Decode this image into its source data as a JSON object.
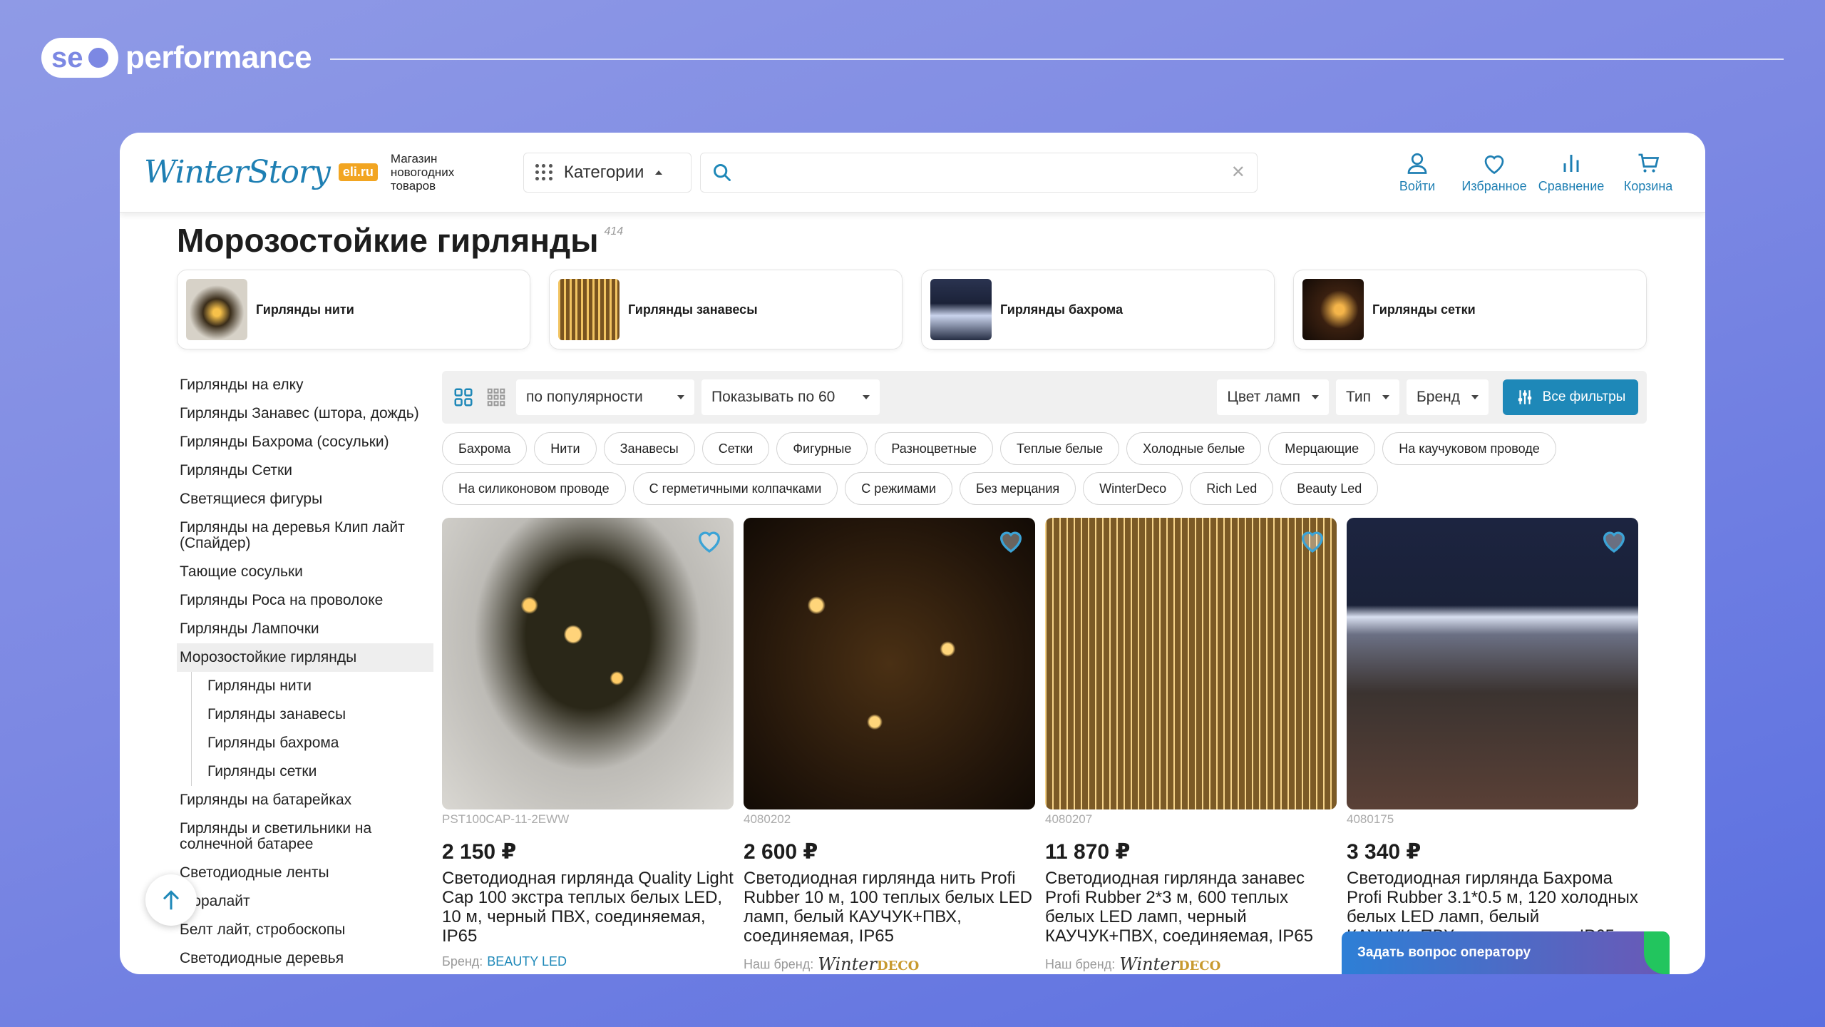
{
  "brand": {
    "pill": "se",
    "word": "performance"
  },
  "header": {
    "logo": "WinterStory",
    "logo_badge": "eli.ru",
    "logo_sub": "Магазин новогодних товаров",
    "categories": "Категории",
    "search_value": "",
    "actions": {
      "login": "Войти",
      "favorites": "Избранное",
      "compare": "Сравнение",
      "cart": "Корзина"
    }
  },
  "page": {
    "title": "Морозостойкие гирлянды",
    "count": "414"
  },
  "subcategories": [
    "Гирлянды нити",
    "Гирлянды занавесы",
    "Гирлянды бахрома",
    "Гирлянды сетки"
  ],
  "sidebar": {
    "items": [
      "Гирлянды на елку",
      "Гирлянды Занавес (штора, дождь)",
      "Гирлянды Бахрома (сосульки)",
      "Гирлянды Сетки",
      "Светящиеся фигуры",
      "Гирлянды на деревья Клип лайт (Спайдер)",
      "Тающие сосульки",
      "Гирлянды Роса на проволоке",
      "Гирлянды Лампочки"
    ],
    "active": "Морозостойкие гирлянды",
    "subitems": [
      "Гирлянды нити",
      "Гирлянды занавесы",
      "Гирлянды бахрома",
      "Гирлянды сетки"
    ],
    "items_after": [
      "Гирлянды на батарейках",
      "Гирлянды и светильники на солнечной батарее",
      "Светодиодные ленты",
      "Дюралайт",
      "Белт лайт, стробоскопы",
      "Светодиодные деревья"
    ]
  },
  "toolbar": {
    "sort": "по популярности",
    "per_page": "Показывать по 60",
    "lamp_color": "Цвет ламп",
    "type": "Тип",
    "brand": "Бренд",
    "all_filters": "Все фильтры"
  },
  "tags": [
    "Бахрома",
    "Нити",
    "Занавесы",
    "Сетки",
    "Фигурные",
    "Разноцветные",
    "Теплые белые",
    "Холодные белые",
    "Мерцающие",
    "На каучуковом проводе",
    "На силиконовом проводе",
    "С герметичными колпачками",
    "С режимами",
    "Без мерцания",
    "WinterDeco",
    "Rich Led",
    "Beauty Led"
  ],
  "products": [
    {
      "sku": "PST100CAP-11-2EWW",
      "price": "2 150 ₽",
      "name": "Светодиодная гирлянда Quality Light Cap 100 экстра теплых белых LED, 10 м, черный ПВХ, соединяемая, IP65",
      "brand_label": "Бренд:",
      "brand": "BEAUTY LED"
    },
    {
      "sku": "4080202",
      "price": "2 600 ₽",
      "name": "Светодиодная гирлянда нить Profi Rubber 10 м, 100 теплых белых LED ламп, белый КАУЧУК+ПВХ, соединяемая, IP65",
      "brand_label": "Наш бренд:",
      "brand": "Winter",
      "brand2": "DECO"
    },
    {
      "sku": "4080207",
      "price": "11 870 ₽",
      "name": "Светодиодная гирлянда занавес Profi Rubber 2*3 м, 600 теплых белых LED ламп, черный КАУЧУК+ПВХ, соединяемая, IP65",
      "brand_label": "Наш бренд:",
      "brand": "Winter",
      "brand2": "DECO"
    },
    {
      "sku": "4080175",
      "price": "3 340 ₽",
      "name": "Светодиодная гирлянда Бахрома Profi Rubber 3.1*0.5 м, 120 холодных белых LED ламп, белый КАУЧУК+ПВХ, соединяемая, IP65"
    }
  ],
  "operator": "Задать вопрос оператору",
  "colors": {
    "accent": "#1e88b8",
    "background": "#7c88e3"
  }
}
